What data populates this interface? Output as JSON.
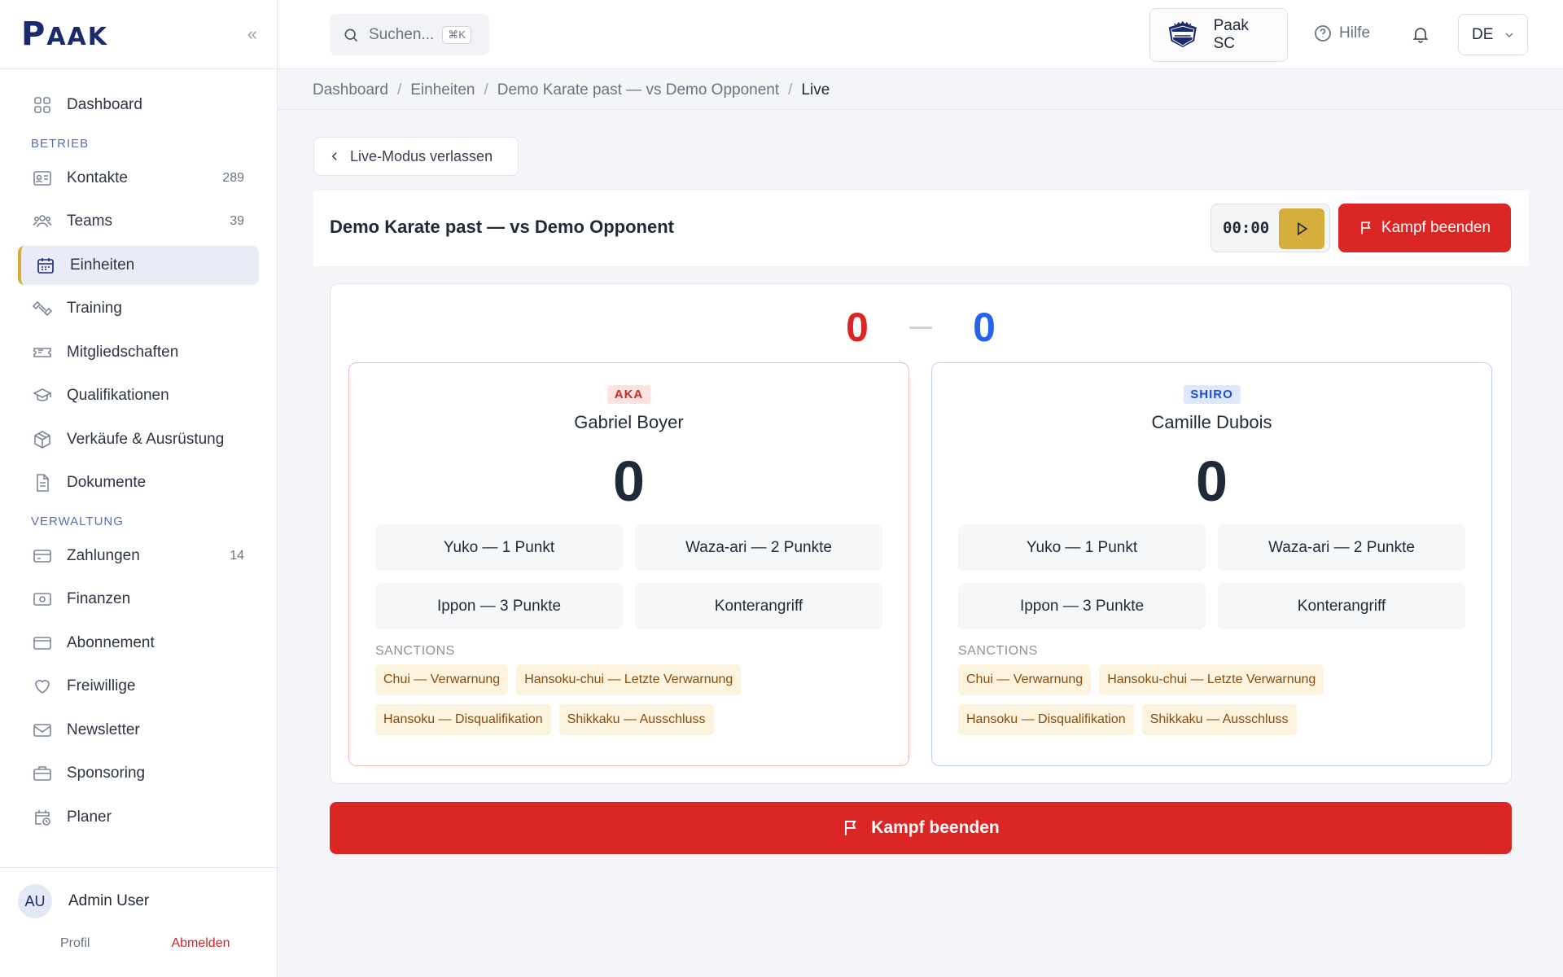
{
  "brand": {
    "logo_p": "P",
    "logo_rest": "AAK"
  },
  "sidebar": {
    "items_top": [
      {
        "label": "Dashboard",
        "icon": "grid-icon"
      }
    ],
    "section_betrieb": "BETRIEB",
    "betrieb": [
      {
        "label": "Kontakte",
        "count": "289"
      },
      {
        "label": "Teams",
        "count": "39"
      },
      {
        "label": "Einheiten",
        "count": ""
      },
      {
        "label": "Training",
        "count": ""
      },
      {
        "label": "Mitgliedschaften",
        "count": ""
      },
      {
        "label": "Qualifikationen",
        "count": ""
      },
      {
        "label": "Verkäufe & Ausrüstung",
        "count": ""
      },
      {
        "label": "Dokumente",
        "count": ""
      }
    ],
    "section_verwaltung": "VERWALTUNG",
    "verwaltung": [
      {
        "label": "Zahlungen",
        "count": "14"
      },
      {
        "label": "Finanzen",
        "count": ""
      },
      {
        "label": "Abonnement",
        "count": ""
      },
      {
        "label": "Freiwillige",
        "count": ""
      },
      {
        "label": "Newsletter",
        "count": ""
      },
      {
        "label": "Sponsoring",
        "count": ""
      },
      {
        "label": "Planer",
        "count": ""
      }
    ],
    "user": {
      "initials": "AU",
      "name": "Admin User",
      "profile": "Profil",
      "logout": "Abmelden"
    }
  },
  "header": {
    "search_placeholder": "Suchen...",
    "search_shortcut": "⌘K",
    "org_name": "Paak SC",
    "help": "Hilfe",
    "lang": "DE"
  },
  "breadcrumb": [
    "Dashboard",
    "Einheiten",
    "Demo Karate past — vs Demo Opponent",
    "Live"
  ],
  "leave_label": "Live-Modus verlassen",
  "match": {
    "title": "Demo Karate past — vs Demo Opponent",
    "timer": "00:00",
    "end_label": "Kampf beenden",
    "score_aka": "0",
    "score_shiro": "0"
  },
  "fighters": {
    "aka": {
      "tag": "AKA",
      "name": "Gabriel Boyer",
      "score": "0",
      "actions": [
        "Yuko — 1 Punkt",
        "Waza-ari — 2 Punkte",
        "Ippon — 3 Punkte",
        "Konterangriff"
      ],
      "sanctions_label": "SANCTIONS",
      "sanctions": [
        "Chui — Verwarnung",
        "Hansoku-chui — Letzte Verwarnung",
        "Hansoku — Disqualifikation",
        "Shikkaku — Ausschluss"
      ]
    },
    "shiro": {
      "tag": "SHIRO",
      "name": "Camille Dubois",
      "score": "0",
      "actions": [
        "Yuko — 1 Punkt",
        "Waza-ari — 2 Punkte",
        "Ippon — 3 Punkte",
        "Konterangriff"
      ],
      "sanctions_label": "SANCTIONS",
      "sanctions": [
        "Chui — Verwarnung",
        "Hansoku-chui — Letzte Verwarnung",
        "Hansoku — Disqualifikation",
        "Shikkaku — Ausschluss"
      ]
    }
  },
  "colors": {
    "brand": "#1b2a6b",
    "accent": "#d4ad3a",
    "danger": "#dc2626",
    "aka": "#dc2626",
    "shiro": "#2563eb"
  }
}
